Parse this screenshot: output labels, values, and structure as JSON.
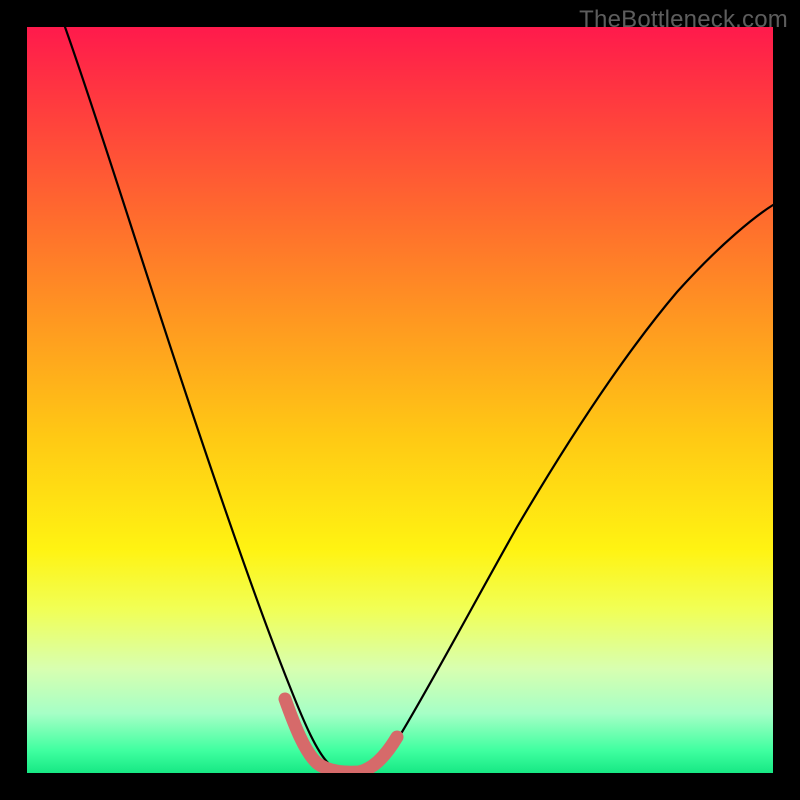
{
  "watermark": "TheBottleneck.com",
  "chart_data": {
    "type": "line",
    "title": "",
    "xlabel": "",
    "ylabel": "",
    "xlim": [
      0,
      100
    ],
    "ylim": [
      0,
      100
    ],
    "series": [
      {
        "name": "main-curve",
        "x": [
          5,
          10,
          15,
          20,
          25,
          30,
          32,
          34,
          36,
          38,
          40,
          42,
          44,
          46,
          50,
          55,
          60,
          65,
          70,
          75,
          80,
          85,
          90,
          95,
          100
        ],
        "y": [
          100,
          86,
          73,
          60,
          47,
          30,
          22,
          14,
          7,
          3,
          1,
          0,
          0,
          1,
          4,
          10,
          18,
          26,
          34,
          42,
          50,
          57,
          63,
          68,
          72
        ]
      },
      {
        "name": "highlight-segment",
        "x": [
          34,
          36,
          38,
          40,
          42,
          44,
          46,
          48
        ],
        "y": [
          10,
          5,
          2,
          0.5,
          0,
          0.5,
          2,
          4
        ]
      }
    ],
    "annotations": []
  }
}
